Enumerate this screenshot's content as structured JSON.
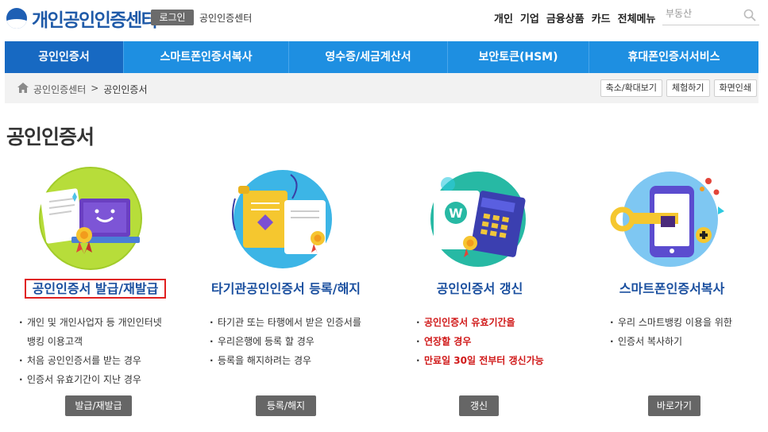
{
  "header": {
    "logo_text": "개인공인인증센터",
    "login_label": "로그인",
    "site_name": "공인인증센터",
    "topnav": [
      "개인",
      "기업",
      "금융상품",
      "카드",
      "전체메뉴"
    ],
    "search": {
      "placeholder": "부동산"
    }
  },
  "mainnav": {
    "tabs": [
      "공인인증서",
      "스마트폰인증서복사",
      "영수증/세금계산서",
      "보안토큰(HSM)",
      "휴대폰인증서서비스"
    ]
  },
  "breadcrumb": {
    "items": [
      "공인인증센터",
      ">",
      "공인인증서"
    ],
    "tools": [
      "축소/확대보기",
      "체험하기",
      "화면인쇄"
    ]
  },
  "page": {
    "title": "공인인증서"
  },
  "cards": [
    {
      "title": "공인인증서 발급/재발급",
      "items": [
        "개인 및 개인사업자 등 개인인터넷",
        "뱅킹 이용고객",
        "처음 공인인증서를 받는 경우",
        "인증서 유효기간이 지난 경우"
      ],
      "button": "발급/재발급"
    },
    {
      "title": "타기관공인인증서 등록/해지",
      "items": [
        "타기관 또는 타행에서 받은 인증서를",
        "우리은행에 등록 할 경우",
        "등록을 해지하려는 경우"
      ],
      "button": "등록/해지"
    },
    {
      "title": "공인인증서 갱신",
      "items": [
        "공인인증서 유효기간을",
        "연장할 경우",
        "만료일 30일 전부터 갱신가능"
      ],
      "button": "갱신"
    },
    {
      "title": "스마트폰인증서복사",
      "items": [
        "우리 스마트뱅킹 이용을 위한",
        "인증서 복사하기"
      ],
      "button": "바로가기"
    }
  ],
  "icons": [
    "logo-icon",
    "search-icon",
    "home-icon",
    "laptop-certificate-icon",
    "documents-certificate-icon",
    "calculator-certificate-icon",
    "smartphone-key-icon"
  ],
  "colors": {
    "nav_blue": "#1e8fe1",
    "nav_active": "#1769c2",
    "title_blue": "#1a4f9f",
    "alert_red": "#d01818"
  }
}
